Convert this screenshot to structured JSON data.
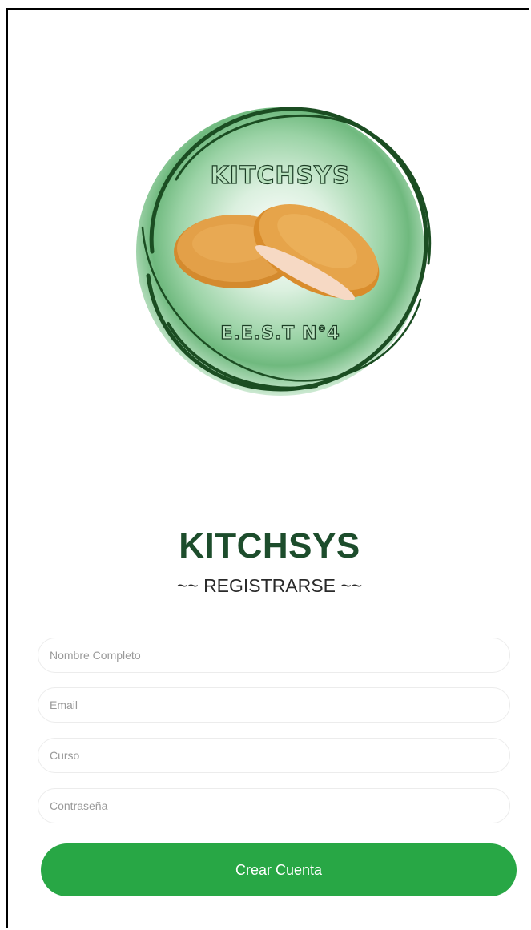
{
  "logo": {
    "top_text": "KITCHSYS",
    "bottom_text": "E.E.S.T N°4",
    "food_image": "breaded-cutlet-image"
  },
  "header": {
    "title": "KITCHSYS",
    "subtitle": "~~ REGISTRARSE ~~"
  },
  "form": {
    "full_name": {
      "placeholder": "Nombre Completo",
      "value": ""
    },
    "email": {
      "placeholder": "Email",
      "value": ""
    },
    "course": {
      "placeholder": "Curso",
      "value": ""
    },
    "password": {
      "placeholder": "Contraseña",
      "value": ""
    },
    "submit_label": "Crear Cuenta"
  },
  "colors": {
    "accent": "#28a745",
    "title": "#1d4d2c",
    "logo_ring": "#1b4d22"
  }
}
